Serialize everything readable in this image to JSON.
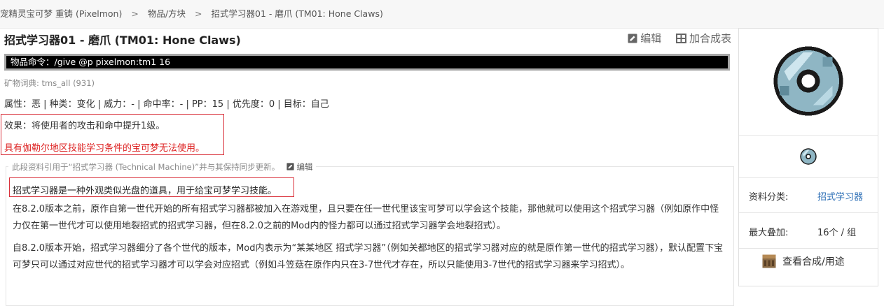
{
  "breadcrumb": {
    "items": [
      "宠精灵宝可梦 重铸 (Pixelmon)",
      "物品/方块",
      "招式学习器01 - 磨爪 (TM01: Hone Claws)"
    ],
    "separator": ">"
  },
  "page": {
    "title": "招式学习器01 - 磨爪 (TM01: Hone Claws)",
    "edit_label": "编辑",
    "add_recipe_label": "加合成表"
  },
  "command": {
    "label": "物品命令：",
    "value": "/give @p pixelmon:tm1 16"
  },
  "dictionary": "矿物词典: tms_all (931)",
  "attributes": "属性：恶 | 种类：变化 | 威力：- | 命中率：- | PP：15 | 优先度：0 | 目标：自己",
  "effect": "效果：将使用者的攻击和命中提升1级。",
  "warning": "具有伽勒尔地区技能学习条件的宝可梦无法使用。",
  "quote": {
    "note": "此段资料引用于“招式学习器 (Technical Machine)”并与其保持同步更新。",
    "edit_label": "编辑",
    "p1": "招式学习器是一种外观类似光盘的道具，用于给宝可梦学习技能。",
    "p2": "在8.2.0版本之前，原作自第一世代开始的所有招式学习器都被加入在游戏里，且只要在任一世代里该宝可梦可以学会这个技能，那他就可以使用这个招式学习器（例如原作中怪力仅在第一世代才可以使用地裂招式的招式学习器，但在8.2.0之前的Mod内的怪力都可以通过招式学习器学会地裂招式）。",
    "p3": "自8.2.0版本开始，招式学习器细分了各个世代的版本，Mod内表示为“某某地区 招式学习器”（例如关都地区的招式学习器对应的就是原作第一世代的招式学习器），默认配置下宝可梦只可以通过对应世代的招式学习器才可以学会对应招式（例如斗笠菇在原作内只在3-7世代才存在，所以只能使用3-7世代的招式学习器来学习招式）。"
  },
  "sidebar": {
    "category_key": "资料分类:",
    "category_value": "招式学习器",
    "stack_key": "最大叠加:",
    "stack_value": "16个 / 组",
    "craft_label": "查看合成/用途"
  },
  "colors": {
    "accent_red": "#d9303a",
    "link_blue": "#2a6db5",
    "command_bg": "#000000"
  }
}
